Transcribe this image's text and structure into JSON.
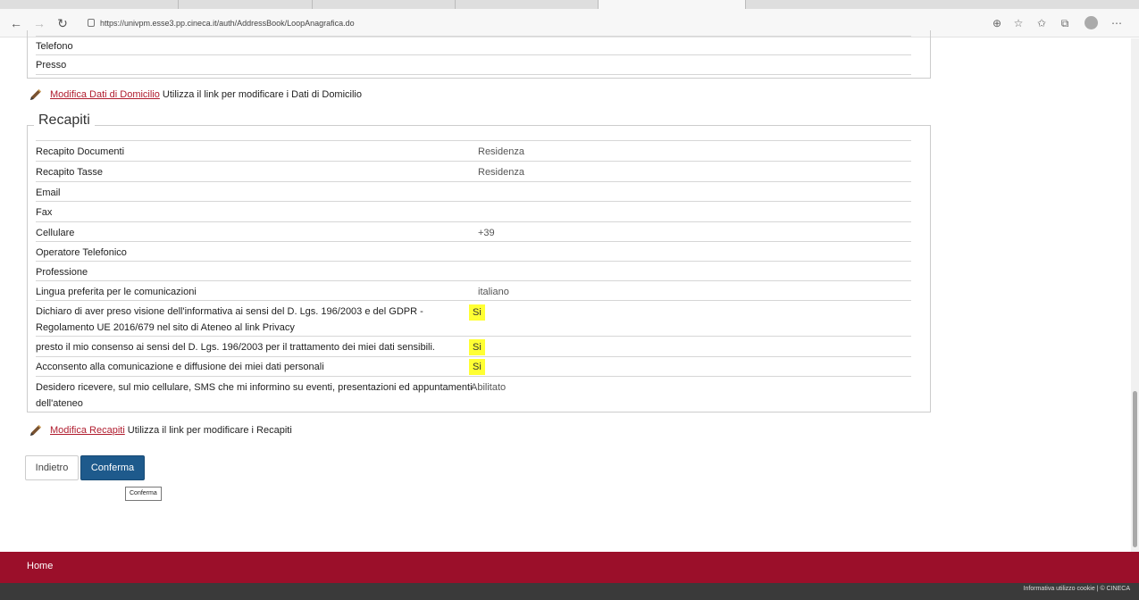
{
  "browser": {
    "url": "https://univpm.esse3.pp.cineca.it/auth/AddressBook/LoopAnagrafica.do"
  },
  "domicilio": {
    "rows": [
      {
        "label": "Telefono",
        "value": ""
      },
      {
        "label": "Presso",
        "value": ""
      }
    ],
    "edit_link": "Modifica Dati di Domicilio",
    "edit_desc": "Utilizza il link per modificare i Dati di Domicilio"
  },
  "recapiti": {
    "legend": "Recapiti",
    "rows": [
      {
        "label": "Recapito Documenti",
        "value": "Residenza"
      },
      {
        "label": "Recapito Tasse",
        "value": "Residenza"
      },
      {
        "label": "Email",
        "value": ""
      },
      {
        "label": "Fax",
        "value": ""
      },
      {
        "label": "Cellulare",
        "value": "+39"
      },
      {
        "label": "Operatore Telefonico",
        "value": ""
      },
      {
        "label": "Professione",
        "value": ""
      },
      {
        "label": "Lingua preferita per le comunicazioni",
        "value": "italiano"
      },
      {
        "label": "Dichiaro di aver preso visione dell'informativa ai sensi del D. Lgs. 196/2003 e del GDPR - Regolamento UE 2016/679 nel sito di Ateneo al link Privacy",
        "value": "Si"
      },
      {
        "label": "presto il mio consenso ai sensi del D. Lgs. 196/2003 per il trattamento dei miei dati sensibili.",
        "value": "Si"
      },
      {
        "label": "Acconsento alla comunicazione e diffusione dei miei dati personali",
        "value": "Si"
      },
      {
        "label": "Desidero ricevere, sul mio cellulare, SMS che mi informino su eventi, presentazioni ed appuntamenti dell'ateneo",
        "value": "Abilitato"
      }
    ],
    "edit_link": "Modifica Recapiti",
    "edit_desc": "Utilizza il link per modificare i Recapiti"
  },
  "buttons": {
    "back": "Indietro",
    "confirm": "Conferma",
    "tooltip": "Conferma"
  },
  "footer": {
    "home": "Home",
    "info": "Informativa utilizzo cookie | © CINECA"
  },
  "colors": {
    "brand": "#9b0f2a",
    "button_primary": "#1e5a8c",
    "highlight": "#ffff33",
    "link": "#b01c2e"
  }
}
